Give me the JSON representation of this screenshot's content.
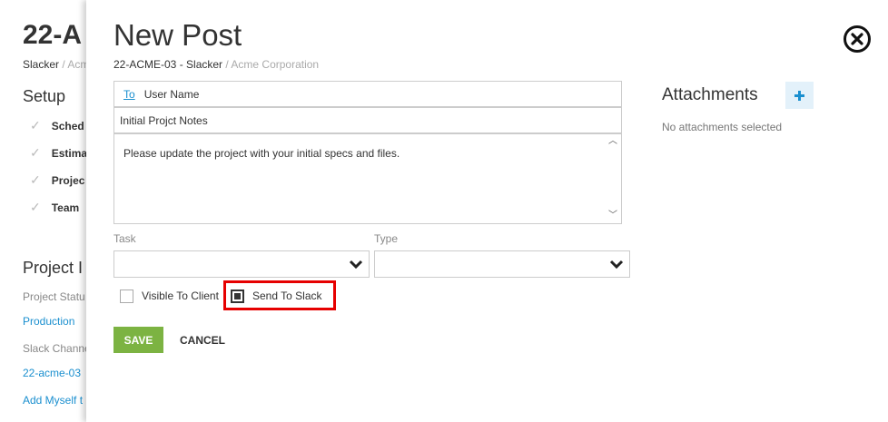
{
  "background": {
    "title": "22-A",
    "breadcrumb_primary": "Slacker",
    "breadcrumb_secondary": "/ Acme",
    "setup_heading": "Setup",
    "setup_items": [
      "Sched",
      "Estima",
      "Projec",
      "Team"
    ],
    "project_info_heading": "Project I",
    "project_status_label": "Project Statu",
    "project_status_value": "Production",
    "slack_channel_label": "Slack Channe",
    "slack_channel_value": "22-acme-03",
    "add_myself_link": "Add Myself t"
  },
  "modal": {
    "title": "New Post",
    "breadcrumb_primary": "22-ACME-03 - Slacker",
    "breadcrumb_secondary": "/ Acme Corporation",
    "to_link": "To",
    "to_value": "User Name",
    "subject_value": "Initial Projct Notes",
    "body_value": "Please update the project with your initial specs and files.",
    "task_label": "Task",
    "task_value": "",
    "type_label": "Type",
    "type_value": "",
    "visible_to_client_label": "Visible To Client",
    "visible_to_client_checked": false,
    "send_to_slack_label": "Send To Slack",
    "send_to_slack_checked": true,
    "save_label": "SAVE",
    "cancel_label": "CANCEL"
  },
  "attachments": {
    "title": "Attachments",
    "empty_text": "No attachments selected"
  },
  "colors": {
    "accent_link": "#1a8fcf",
    "save_button": "#7cb342",
    "highlight": "#e60000",
    "add_button_bg": "#e3f1fa"
  },
  "icons": {
    "close": "close-circle-icon",
    "add": "plus-icon",
    "dropdown": "chevron-down-icon",
    "check": "checkmark-icon"
  }
}
